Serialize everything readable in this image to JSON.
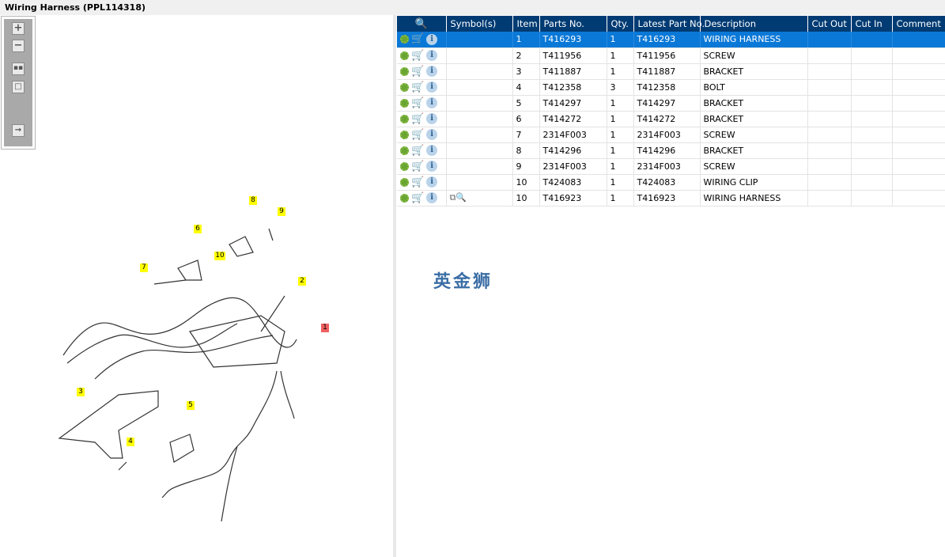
{
  "title": "Wiring Harness (PPL114318)",
  "toolbar": {
    "zoom_in": "+",
    "zoom_out": "−"
  },
  "watermark": "英金狮",
  "callouts": [
    "1",
    "2",
    "3",
    "4",
    "5",
    "6",
    "7",
    "8",
    "9",
    "10"
  ],
  "grid": {
    "columns": [
      "",
      "Symbol(s)",
      "Item",
      "Parts No.",
      "Qty.",
      "Latest Part No.",
      "Description",
      "Cut Out",
      "Cut In",
      "Comment"
    ],
    "rows": [
      {
        "item": "1",
        "part": "T416293",
        "qty": "1",
        "latest": "T416293",
        "desc": "WIRING HARNESS",
        "selected": true
      },
      {
        "item": "2",
        "part": "T411956",
        "qty": "1",
        "latest": "T411956",
        "desc": "SCREW"
      },
      {
        "item": "3",
        "part": "T411887",
        "qty": "1",
        "latest": "T411887",
        "desc": "BRACKET"
      },
      {
        "item": "4",
        "part": "T412358",
        "qty": "3",
        "latest": "T412358",
        "desc": "BOLT"
      },
      {
        "item": "5",
        "part": "T414297",
        "qty": "1",
        "latest": "T414297",
        "desc": "BRACKET"
      },
      {
        "item": "6",
        "part": "T414272",
        "qty": "1",
        "latest": "T414272",
        "desc": "BRACKET"
      },
      {
        "item": "7",
        "part": "2314F003",
        "qty": "1",
        "latest": "2314F003",
        "desc": "SCREW"
      },
      {
        "item": "8",
        "part": "T414296",
        "qty": "1",
        "latest": "T414296",
        "desc": "BRACKET"
      },
      {
        "item": "9",
        "part": "2314F003",
        "qty": "1",
        "latest": "2314F003",
        "desc": "SCREW"
      },
      {
        "item": "10",
        "part": "T424083",
        "qty": "1",
        "latest": "T424083",
        "desc": "WIRING CLIP"
      },
      {
        "item": "10",
        "part": "T416923",
        "qty": "1",
        "latest": "T416923",
        "desc": "WIRING HARNESS",
        "symbol": "zoom-doc"
      }
    ]
  },
  "colors": {
    "header": "#003b73",
    "selected": "#0a78d7",
    "callout": "#ffff00"
  }
}
